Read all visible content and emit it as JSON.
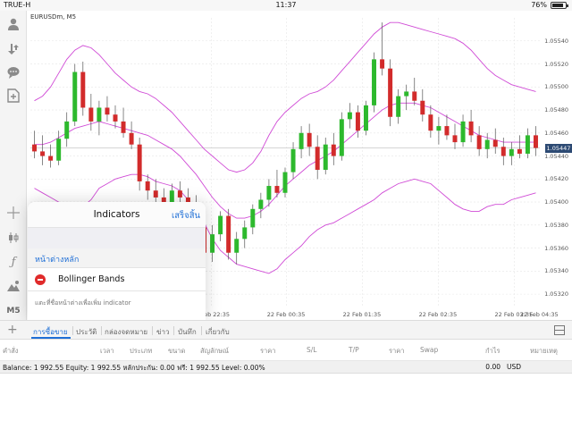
{
  "status_bar": {
    "carrier": "TRUE-H",
    "time": "11:37",
    "battery": "76%"
  },
  "toolbar": {
    "items": [
      "user-icon",
      "trade-icon",
      "chat-icon",
      "new-order-icon",
      "crosshair-icon",
      "candles-icon",
      "indicator-icon",
      "objects-icon"
    ],
    "timeframe": "M5"
  },
  "chart": {
    "symbol": "EURUSDm, M5",
    "price_labels": [
      "1.05540",
      "1.05520",
      "1.05500",
      "1.05480",
      "1.05460",
      "1.05440",
      "1.05420",
      "1.05400",
      "1.05380",
      "1.05360",
      "1.05340",
      "1.05320"
    ],
    "current_price": "1.05447",
    "time_labels": [
      "21 Feb 22:35",
      "22 Feb 00:35",
      "22 Feb 01:35",
      "22 Feb 02:35",
      "22 Feb 03:35",
      "22 Feb 04:35"
    ],
    "colors": {
      "bull": "#2db92d",
      "bear": "#d22b2b",
      "band": "#d04bd6",
      "grid": "#e6e6e6",
      "current_line": "#cfcfcf"
    }
  },
  "chart_data": {
    "type": "candlestick",
    "price_range": [
      1.0531,
      1.0556
    ],
    "candles": [
      {
        "o": 1.0545,
        "h": 1.05462,
        "l": 1.05438,
        "c": 1.05444
      },
      {
        "o": 1.05444,
        "h": 1.05458,
        "l": 1.05432,
        "c": 1.0544
      },
      {
        "o": 1.0544,
        "h": 1.0545,
        "l": 1.0543,
        "c": 1.05436
      },
      {
        "o": 1.05436,
        "h": 1.05462,
        "l": 1.05432,
        "c": 1.05455
      },
      {
        "o": 1.05455,
        "h": 1.05478,
        "l": 1.05448,
        "c": 1.0547
      },
      {
        "o": 1.0547,
        "h": 1.0552,
        "l": 1.05466,
        "c": 1.05513
      },
      {
        "o": 1.05513,
        "h": 1.05522,
        "l": 1.05475,
        "c": 1.05482
      },
      {
        "o": 1.05482,
        "h": 1.05494,
        "l": 1.05462,
        "c": 1.0547
      },
      {
        "o": 1.0547,
        "h": 1.05488,
        "l": 1.05458,
        "c": 1.05482
      },
      {
        "o": 1.05482,
        "h": 1.05492,
        "l": 1.0547,
        "c": 1.05476
      },
      {
        "o": 1.05476,
        "h": 1.05484,
        "l": 1.05464,
        "c": 1.0547
      },
      {
        "o": 1.0547,
        "h": 1.05482,
        "l": 1.05456,
        "c": 1.0546
      },
      {
        "o": 1.0546,
        "h": 1.0547,
        "l": 1.05446,
        "c": 1.0545
      },
      {
        "o": 1.0545,
        "h": 1.05456,
        "l": 1.0541,
        "c": 1.05418
      },
      {
        "o": 1.05418,
        "h": 1.05424,
        "l": 1.05402,
        "c": 1.0541
      },
      {
        "o": 1.0541,
        "h": 1.0542,
        "l": 1.05396,
        "c": 1.05404
      },
      {
        "o": 1.05404,
        "h": 1.05412,
        "l": 1.05392,
        "c": 1.054
      },
      {
        "o": 1.054,
        "h": 1.05416,
        "l": 1.05394,
        "c": 1.0541
      },
      {
        "o": 1.0541,
        "h": 1.05418,
        "l": 1.054,
        "c": 1.05404
      },
      {
        "o": 1.05404,
        "h": 1.05412,
        "l": 1.05392,
        "c": 1.05398
      },
      {
        "o": 1.05398,
        "h": 1.05406,
        "l": 1.0537,
        "c": 1.05378
      },
      {
        "o": 1.05378,
        "h": 1.05386,
        "l": 1.0535,
        "c": 1.05356
      },
      {
        "o": 1.05356,
        "h": 1.0538,
        "l": 1.05348,
        "c": 1.05372
      },
      {
        "o": 1.05372,
        "h": 1.05392,
        "l": 1.05366,
        "c": 1.05388
      },
      {
        "o": 1.05388,
        "h": 1.05394,
        "l": 1.0535,
        "c": 1.05356
      },
      {
        "o": 1.05356,
        "h": 1.05374,
        "l": 1.05346,
        "c": 1.05368
      },
      {
        "o": 1.05368,
        "h": 1.05384,
        "l": 1.0536,
        "c": 1.05378
      },
      {
        "o": 1.05378,
        "h": 1.05398,
        "l": 1.05372,
        "c": 1.05394
      },
      {
        "o": 1.05394,
        "h": 1.05408,
        "l": 1.05386,
        "c": 1.05402
      },
      {
        "o": 1.05402,
        "h": 1.0542,
        "l": 1.05396,
        "c": 1.05414
      },
      {
        "o": 1.05414,
        "h": 1.05428,
        "l": 1.05404,
        "c": 1.05408
      },
      {
        "o": 1.05408,
        "h": 1.0543,
        "l": 1.05404,
        "c": 1.05426
      },
      {
        "o": 1.05426,
        "h": 1.05452,
        "l": 1.0542,
        "c": 1.05446
      },
      {
        "o": 1.05446,
        "h": 1.05466,
        "l": 1.05438,
        "c": 1.0546
      },
      {
        "o": 1.0546,
        "h": 1.05468,
        "l": 1.0544,
        "c": 1.05448
      },
      {
        "o": 1.05448,
        "h": 1.05458,
        "l": 1.0542,
        "c": 1.05428
      },
      {
        "o": 1.05428,
        "h": 1.05456,
        "l": 1.05424,
        "c": 1.0545
      },
      {
        "o": 1.0545,
        "h": 1.0546,
        "l": 1.05432,
        "c": 1.0544
      },
      {
        "o": 1.0544,
        "h": 1.05478,
        "l": 1.05436,
        "c": 1.05472
      },
      {
        "o": 1.05472,
        "h": 1.05486,
        "l": 1.05464,
        "c": 1.05478
      },
      {
        "o": 1.05478,
        "h": 1.05484,
        "l": 1.05456,
        "c": 1.05462
      },
      {
        "o": 1.05462,
        "h": 1.05488,
        "l": 1.05458,
        "c": 1.05484
      },
      {
        "o": 1.05484,
        "h": 1.0553,
        "l": 1.05478,
        "c": 1.05524
      },
      {
        "o": 1.05524,
        "h": 1.05556,
        "l": 1.0551,
        "c": 1.05516
      },
      {
        "o": 1.05516,
        "h": 1.05524,
        "l": 1.05466,
        "c": 1.05474
      },
      {
        "o": 1.05474,
        "h": 1.05498,
        "l": 1.05468,
        "c": 1.05492
      },
      {
        "o": 1.05492,
        "h": 1.05502,
        "l": 1.0548,
        "c": 1.05496
      },
      {
        "o": 1.05496,
        "h": 1.05508,
        "l": 1.05484,
        "c": 1.05488
      },
      {
        "o": 1.05488,
        "h": 1.05498,
        "l": 1.0547,
        "c": 1.05476
      },
      {
        "o": 1.05476,
        "h": 1.05484,
        "l": 1.05456,
        "c": 1.05462
      },
      {
        "o": 1.05462,
        "h": 1.05474,
        "l": 1.0545,
        "c": 1.05466
      },
      {
        "o": 1.05466,
        "h": 1.05476,
        "l": 1.05454,
        "c": 1.05458
      },
      {
        "o": 1.05458,
        "h": 1.05468,
        "l": 1.05446,
        "c": 1.05452
      },
      {
        "o": 1.05452,
        "h": 1.05476,
        "l": 1.05448,
        "c": 1.0547
      },
      {
        "o": 1.0547,
        "h": 1.0548,
        "l": 1.05452,
        "c": 1.05458
      },
      {
        "o": 1.05458,
        "h": 1.05466,
        "l": 1.0544,
        "c": 1.05446
      },
      {
        "o": 1.05446,
        "h": 1.0546,
        "l": 1.05438,
        "c": 1.05454
      },
      {
        "o": 1.05454,
        "h": 1.05464,
        "l": 1.05442,
        "c": 1.05448
      },
      {
        "o": 1.05448,
        "h": 1.05456,
        "l": 1.05432,
        "c": 1.0544
      },
      {
        "o": 1.0544,
        "h": 1.05452,
        "l": 1.05432,
        "c": 1.05446
      },
      {
        "o": 1.05446,
        "h": 1.05458,
        "l": 1.05438,
        "c": 1.05442
      },
      {
        "o": 1.05442,
        "h": 1.05464,
        "l": 1.05438,
        "c": 1.05458
      },
      {
        "o": 1.05458,
        "h": 1.05466,
        "l": 1.0544,
        "c": 1.05447
      }
    ],
    "bollinger": {
      "upper": [
        1.05488,
        1.05492,
        1.055,
        1.05512,
        1.05524,
        1.05532,
        1.05536,
        1.05534,
        1.05528,
        1.0552,
        1.05512,
        1.05506,
        1.055,
        1.05496,
        1.05494,
        1.0549,
        1.05484,
        1.05478,
        1.0547,
        1.05462,
        1.05454,
        1.05446,
        1.0544,
        1.05434,
        1.05428,
        1.05426,
        1.05428,
        1.05434,
        1.05444,
        1.05458,
        1.0547,
        1.05478,
        1.05484,
        1.0549,
        1.05494,
        1.05496,
        1.055,
        1.05506,
        1.05514,
        1.05522,
        1.0553,
        1.05538,
        1.05546,
        1.05552,
        1.05556,
        1.05556,
        1.05554,
        1.05552,
        1.0555,
        1.05548,
        1.05546,
        1.05544,
        1.05542,
        1.05538,
        1.05532,
        1.05524,
        1.05516,
        1.0551,
        1.05506,
        1.05502,
        1.055,
        1.05498,
        1.05496
      ],
      "middle": [
        1.0545,
        1.0545,
        1.05452,
        1.05456,
        1.0546,
        1.05464,
        1.05466,
        1.05468,
        1.0547,
        1.05468,
        1.05466,
        1.05464,
        1.05462,
        1.0546,
        1.05458,
        1.05454,
        1.0545,
        1.05446,
        1.0544,
        1.05432,
        1.05424,
        1.05414,
        1.05404,
        1.05396,
        1.0539,
        1.05386,
        1.05386,
        1.05388,
        1.05392,
        1.05398,
        1.05406,
        1.05414,
        1.0542,
        1.05426,
        1.05432,
        1.05436,
        1.0544,
        1.05444,
        1.0545,
        1.05456,
        1.05462,
        1.05468,
        1.05474,
        1.0548,
        1.05484,
        1.05486,
        1.05486,
        1.05486,
        1.05484,
        1.05482,
        1.05478,
        1.05474,
        1.0547,
        1.05466,
        1.05462,
        1.05458,
        1.05456,
        1.05454,
        1.05452,
        1.05452,
        1.05452,
        1.05452,
        1.05452
      ],
      "lower": [
        1.05412,
        1.05408,
        1.05404,
        1.054,
        1.05396,
        1.05396,
        1.05396,
        1.05402,
        1.05412,
        1.05416,
        1.0542,
        1.05422,
        1.05424,
        1.05424,
        1.05422,
        1.05418,
        1.05416,
        1.05414,
        1.0541,
        1.05402,
        1.05394,
        1.05382,
        1.05368,
        1.05358,
        1.05352,
        1.05346,
        1.05344,
        1.05342,
        1.0534,
        1.05338,
        1.05342,
        1.0535,
        1.05356,
        1.05362,
        1.0537,
        1.05376,
        1.0538,
        1.05382,
        1.05386,
        1.0539,
        1.05394,
        1.05398,
        1.05402,
        1.05408,
        1.05412,
        1.05416,
        1.05418,
        1.0542,
        1.05418,
        1.05416,
        1.0541,
        1.05404,
        1.05398,
        1.05394,
        1.05392,
        1.05392,
        1.05396,
        1.05398,
        1.05398,
        1.05402,
        1.05404,
        1.05406,
        1.05408
      ]
    }
  },
  "indicators_panel": {
    "title": "Indicators",
    "done": "เสร็จสิ้น",
    "section": "หน้าต่างหลัก",
    "items": [
      {
        "name": "Bollinger Bands"
      }
    ],
    "hint": "แตะที่ชื่อหน้าต่างเพื่อเพิ่ม indicator"
  },
  "tabs": {
    "items": [
      {
        "label": "การซื้อขาย",
        "active": true
      },
      {
        "label": "ประวัติ",
        "active": false
      },
      {
        "label": "กล่องจดหมาย",
        "active": false
      },
      {
        "label": "ข่าว",
        "active": false
      },
      {
        "label": "บันทึก",
        "active": false
      },
      {
        "label": "เกี่ยวกับ",
        "active": false
      }
    ]
  },
  "columns": {
    "items": [
      "คำสั่ง",
      "เวลา",
      "ประเภท",
      "ขนาด",
      "สัญลักษณ์",
      "ราคา",
      "S/L",
      "T/P",
      "ราคา",
      "Swap",
      "กำไร",
      "หมายเหตุ"
    ]
  },
  "balance": {
    "text": "Balance: 1 992.55 Equity: 1 992.55 หลักประกัน: 0.00 ฟรี: 1 992.55 Level: 0.00%",
    "amount": "0.00",
    "currency": "USD"
  }
}
